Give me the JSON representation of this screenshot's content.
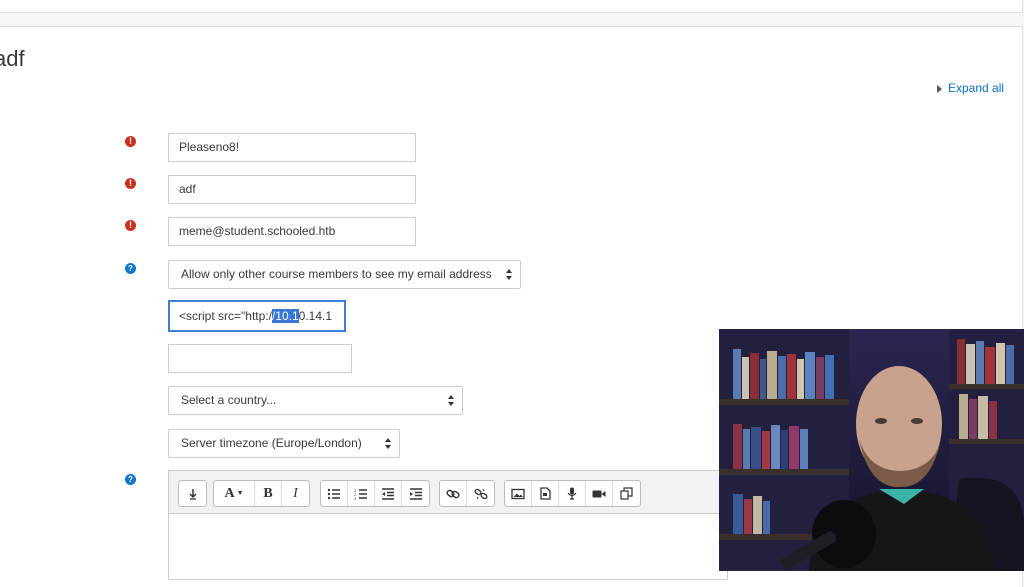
{
  "page": {
    "title": "adf"
  },
  "expand_all": {
    "label": "Expand all"
  },
  "form": {
    "password_value": "Pleaseno8!",
    "name_value": "adf",
    "email_value": "meme@student.schooled.htb",
    "email_display_option": "Allow only other course members to see my email address",
    "moodlenet_value_before": "<script src=\"http:/",
    "moodlenet_value_selected": "/10.1",
    "moodlenet_value_after": "0.14.1",
    "city_value": "",
    "country_select": "Select a country...",
    "timezone_select": "Server timezone (Europe/London)"
  },
  "editor": {
    "toolbar": [
      "collapse-icon",
      "font-style-icon",
      "bold-icon",
      "italic-icon",
      "unordered-list-icon",
      "ordered-list-icon",
      "outdent-icon",
      "indent-icon",
      "link-icon",
      "unlink-icon",
      "image-icon",
      "media-icon",
      "record-audio-icon",
      "record-video-icon",
      "manage-files-icon"
    ]
  },
  "colors": {
    "required": "#ca3120",
    "help": "#1177d1",
    "link": "#0f6fc5",
    "focus": "#3f7fd6",
    "selection": "#3875d7"
  }
}
